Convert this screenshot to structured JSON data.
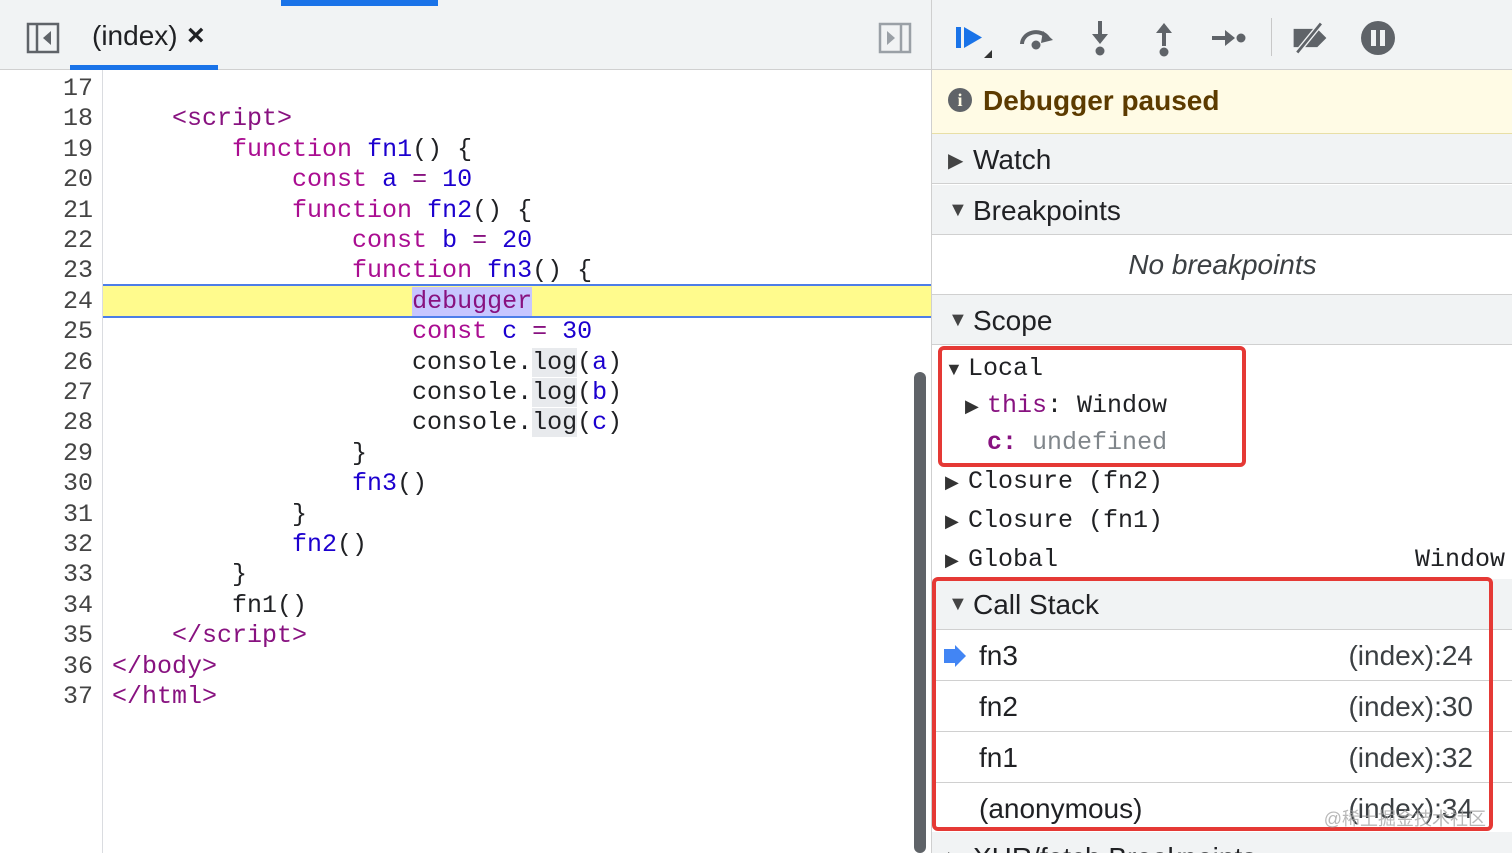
{
  "editor": {
    "tab_label": "(index)",
    "tab_close": "×",
    "lines": [
      {
        "n": "17",
        "html": ""
      },
      {
        "n": "18",
        "html": "    <span class='tag'>&lt;script&gt;</span>"
      },
      {
        "n": "19",
        "html": "        <span class='kw'>function</span> <span class='fn'>fn1</span>() {"
      },
      {
        "n": "20",
        "html": "            <span class='kw'>const</span> <span class='fn'>a</span> <span class='op'>=</span> <span class='num'>10</span>"
      },
      {
        "n": "21",
        "html": "            <span class='kw'>function</span> <span class='fn'>fn2</span>() {"
      },
      {
        "n": "22",
        "html": "                <span class='kw'>const</span> <span class='fn'>b</span> <span class='op'>=</span> <span class='num'>20</span>"
      },
      {
        "n": "23",
        "html": "                <span class='kw'>function</span> <span class='fn'>fn3</span>() {"
      },
      {
        "n": "24",
        "html": "                    <span class='hl'>debugger</span>"
      },
      {
        "n": "25",
        "html": "                    <span class='kw'>const</span> <span class='fn'>c</span> <span class='op'>=</span> <span class='num'>30</span>"
      },
      {
        "n": "26",
        "html": "                    console.<span class='logbg'>log</span>(<span class='fn'>a</span>)"
      },
      {
        "n": "27",
        "html": "                    console.<span class='logbg'>log</span>(<span class='fn'>b</span>)"
      },
      {
        "n": "28",
        "html": "                    console.<span class='logbg'>log</span>(<span class='fn'>c</span>)"
      },
      {
        "n": "29",
        "html": "                }"
      },
      {
        "n": "30",
        "html": "                <span class='fn'>fn3</span>()"
      },
      {
        "n": "31",
        "html": "            }"
      },
      {
        "n": "32",
        "html": "            <span class='fn'>fn2</span>()"
      },
      {
        "n": "33",
        "html": "        }"
      },
      {
        "n": "34",
        "html": "        fn1()"
      },
      {
        "n": "35",
        "html": "    <span class='tag'>&lt;/script&gt;</span>"
      },
      {
        "n": "36",
        "html": "<span class='tag'>&lt;/body&gt;</span>"
      },
      {
        "n": "37",
        "html": "<span class='tag'>&lt;/html&gt;</span>"
      }
    ],
    "current_line": "24"
  },
  "toolbar": {
    "buttons": [
      "resume-icon",
      "step-over-icon",
      "step-into-icon",
      "step-out-icon",
      "step-icon",
      "deactivate-breakpoints-icon",
      "pause-on-exceptions-icon"
    ]
  },
  "debugger": {
    "paused_text": "Debugger paused",
    "sections": {
      "watch": "Watch",
      "breakpoints": "Breakpoints",
      "no_breakpoints": "No breakpoints",
      "scope": "Scope",
      "call_stack": "Call Stack",
      "xhr": "XHR/fetch Breakpoints"
    },
    "scope": {
      "local": "Local",
      "this_key": "this",
      "this_value": "Window",
      "c_key": "c",
      "c_value": "undefined",
      "closure_fn2": "Closure (fn2)",
      "closure_fn1": "Closure (fn1)",
      "global": "Global",
      "global_value": "Window"
    },
    "call_stack": [
      {
        "name": "fn3",
        "loc": "(index):24",
        "current": true
      },
      {
        "name": "fn2",
        "loc": "(index):30",
        "current": false
      },
      {
        "name": "fn1",
        "loc": "(index):32",
        "current": false
      },
      {
        "name": "(anonymous)",
        "loc": "(index):34",
        "current": false
      }
    ]
  },
  "colors": {
    "accent": "#1a73e8",
    "highlight_box": "#e53935",
    "exec_line": "#fffb8d"
  },
  "watermark": "@稀土掘金技术社区"
}
